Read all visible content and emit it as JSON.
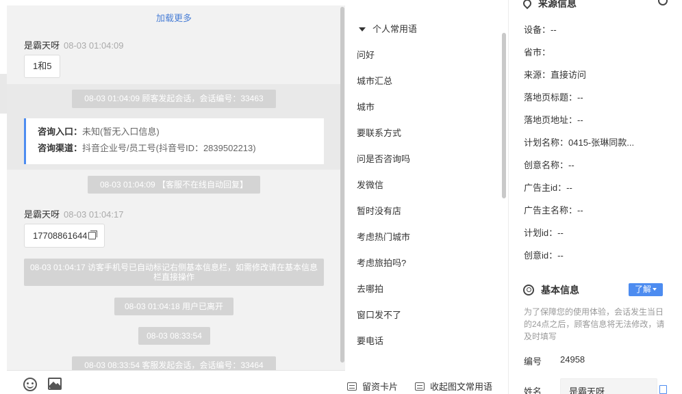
{
  "chat": {
    "load_more": "加载更多",
    "messages": [
      {
        "sender": "是霸天呀",
        "time": "08-03 01:04:09",
        "text": "1和5"
      },
      {
        "sender": "是霸天呀",
        "time": "08-03 01:04:17",
        "text": "17708861644"
      }
    ],
    "system": [
      "08-03 01:04:09 顾客发起会话，会话编号：33463",
      "08-03 01:04:09 【客服不在线自动回复】",
      "08-03 01:04:17 访客手机号已自动标记右侧基本信息栏，如需修改请在基本信息栏直接操作",
      "08-03 01:04:18 用户已离开",
      "08-03 08:33:54",
      "08-03 08:33:54 客服发起会话，会话编号：33464"
    ],
    "consult": {
      "entry_label": "咨询入口：",
      "entry_value": "未知(暂无入口信息)",
      "channel_label": "咨询渠道：",
      "channel_value": "抖音企业号/员工号(抖音号ID：2839502213)"
    }
  },
  "phrases": {
    "header": "个人常用语",
    "items": [
      "问好",
      "城市汇总",
      "城市",
      "要联系方式",
      "问是否咨询吗",
      "发微信",
      "暂时没有店",
      "考虑热门城市",
      "考虑旅拍吗?",
      "去哪拍",
      "窗口发不了",
      "要电话"
    ],
    "footer_card": "留资卡片",
    "footer_collapse": "收起图文常用语"
  },
  "info": {
    "source_title": "来源信息",
    "fields": [
      {
        "label": "设备：",
        "value": "--"
      },
      {
        "label": "省市：",
        "value": ""
      },
      {
        "label": "来源：",
        "value": "直接访问"
      },
      {
        "label": "落地页标题：",
        "value": "--"
      },
      {
        "label": "落地页地址：",
        "value": "--"
      },
      {
        "label": "计划名称：",
        "value": "0415-张琳同款..."
      },
      {
        "label": "创意名称：",
        "value": "--"
      },
      {
        "label": "广告主id：",
        "value": "--"
      },
      {
        "label": "广告主名称：",
        "value": "--"
      },
      {
        "label": "计划id：",
        "value": "--"
      },
      {
        "label": "创意id：",
        "value": "--"
      }
    ],
    "basic_title": "基本信息",
    "learn_more": "了解",
    "notice": "为了保障您的使用体验，会话发生当日的24点之后，顾客信息将无法修改，请及时填写",
    "id_label": "编号",
    "id_value": "24958",
    "name_label": "姓名",
    "name_value": "是霸天呀"
  }
}
